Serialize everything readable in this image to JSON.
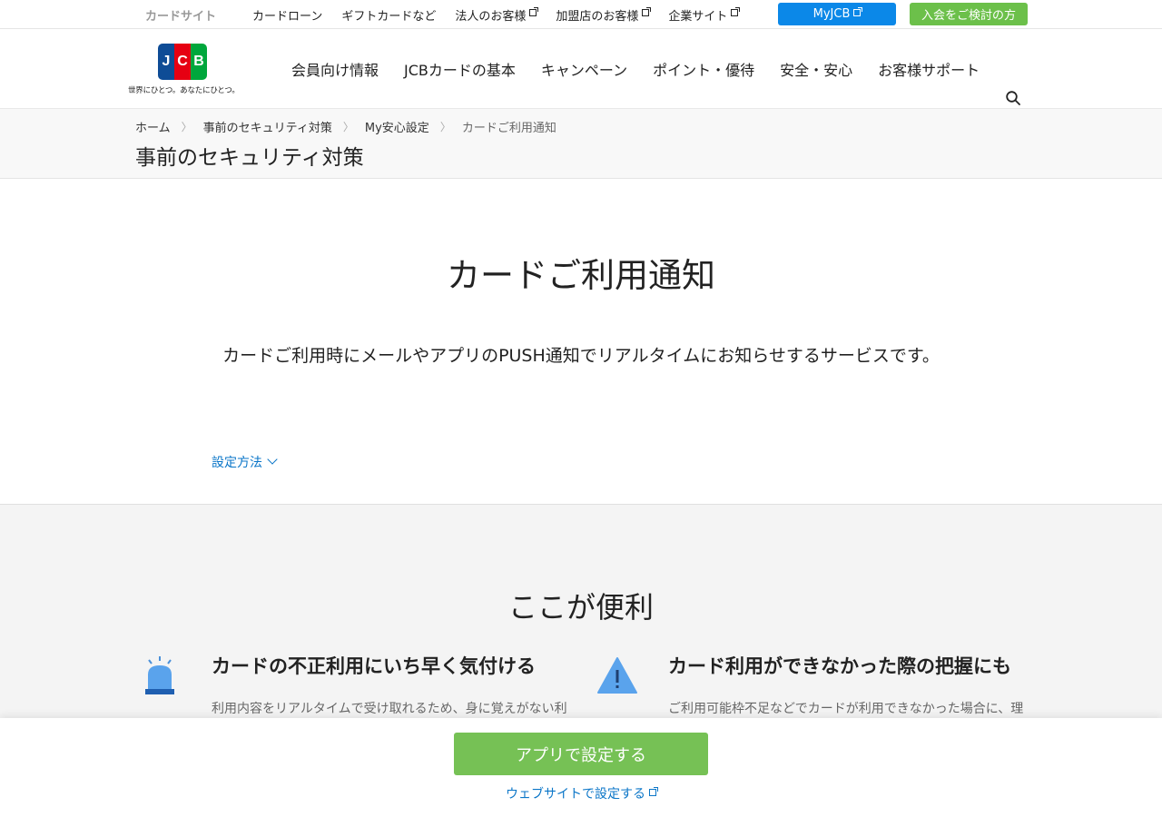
{
  "topbar": {
    "current": "カードサイト",
    "links": [
      "カードローン",
      "ギフトカードなど",
      "法人のお客様",
      "加盟店のお客様",
      "企業サイト"
    ],
    "myjcb": "MyJCB",
    "join": "入会をご検討の方"
  },
  "header": {
    "logo_letters": [
      "J",
      "C",
      "B"
    ],
    "tagline": "世界にひとつ。あなたにひとつ。",
    "nav": [
      "会員向け情報",
      "JCBカードの基本",
      "キャンペーン",
      "ポイント・優待",
      "安全・安心",
      "お客様サポート"
    ]
  },
  "breadcrumb": {
    "items": [
      "ホーム",
      "事前のセキュリティ対策",
      "My安心設定",
      "カードご利用通知"
    ],
    "separator": "〉",
    "section_title": "事前のセキュリティ対策"
  },
  "main": {
    "title": "カードご利用通知",
    "lead": "カードご利用時にメールやアプリのPUSH通知でリアルタイムにお知らせするサービスです。",
    "howto": "設定方法"
  },
  "benefits": {
    "title": "ここが便利",
    "items": [
      {
        "title": "カードの不正利用にいち早く気付ける",
        "desc": "利用内容をリアルタイムで受け取れるため、身に覚えがない利用時のいち早い検知に役立ちます。",
        "icon": "siren-icon"
      },
      {
        "title": "カード利用ができなかった際の把握にも",
        "desc": "ご利用可能枠不足などでカードが利用できなかった場合に、理由をお知らせします。",
        "icon": "warning-icon"
      }
    ]
  },
  "cta": {
    "app_button": "アプリで設定する",
    "web_link": "ウェブサイトで設定する"
  },
  "colors": {
    "myjcb": "#0b88e8",
    "join": "#6cc04a",
    "app_button": "#76c155",
    "link": "#0b76c8"
  }
}
